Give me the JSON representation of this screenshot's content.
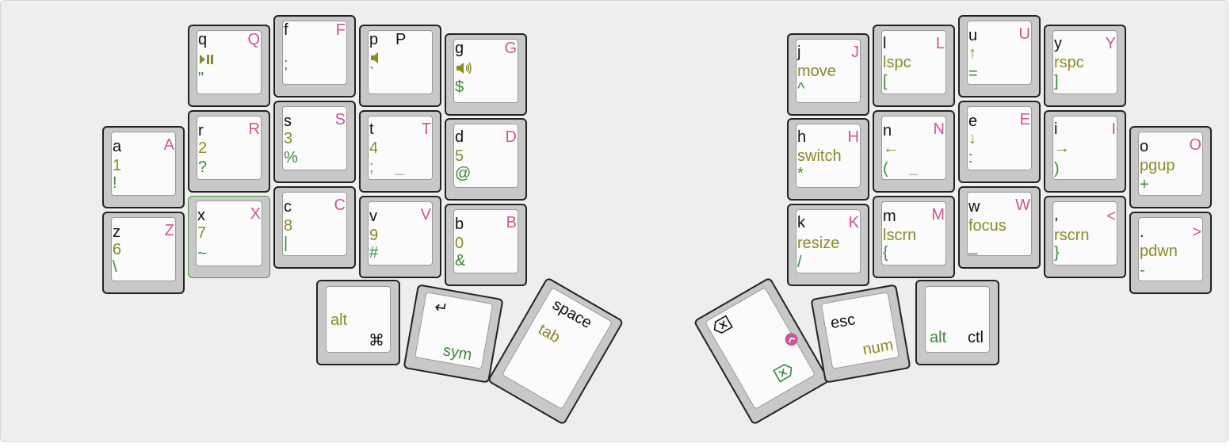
{
  "colors": {
    "base": "#111111",
    "shift": "#cc5599",
    "layer1": "#8a8a26",
    "layer2": "#3a8a3a",
    "dim": "#b0b0b0",
    "highlight": "#4a9a3a"
  },
  "left": {
    "q": {
      "base": "q",
      "shift": "Q",
      "l1": "⏯",
      "l2": "\""
    },
    "f": {
      "base": "f",
      "shift": "F",
      "l1": "",
      "l2": ";"
    },
    "p": {
      "base": "p",
      "shift": "P",
      "l1": "🔈",
      "l2": "`"
    },
    "g": {
      "base": "g",
      "shift": "G",
      "l1": "🔊",
      "l2": "$"
    },
    "a": {
      "base": "a",
      "shift": "A",
      "l1": "1",
      "l2": "!"
    },
    "r": {
      "base": "r",
      "shift": "R",
      "l1": "2",
      "l2": "?"
    },
    "s": {
      "base": "s",
      "shift": "S",
      "l1": "3",
      "l2": "%"
    },
    "t": {
      "base": "t",
      "shift": "T",
      "l1": "4",
      "l2": ";",
      "l2b": "_"
    },
    "d": {
      "base": "d",
      "shift": "D",
      "l1": "5",
      "l2": "@"
    },
    "z": {
      "base": "z",
      "shift": "Z",
      "l1": "6",
      "l2": "\\"
    },
    "x": {
      "base": "x",
      "shift": "X",
      "l1": "7",
      "l2": "~"
    },
    "c": {
      "base": "c",
      "shift": "C",
      "l1": "8",
      "l2": "|"
    },
    "v": {
      "base": "v",
      "shift": "V",
      "l1": "9",
      "l2": "#"
    },
    "b": {
      "base": "b",
      "shift": "B",
      "l1": "0",
      "l2": "&"
    }
  },
  "right": {
    "j": {
      "base": "j",
      "shift": "J",
      "l1": "move",
      "l2": "^"
    },
    "l": {
      "base": "l",
      "shift": "L",
      "l1": "lspc",
      "l2": "["
    },
    "u": {
      "base": "u",
      "shift": "U",
      "l1": "↑",
      "l2": "="
    },
    "y": {
      "base": "y",
      "shift": "Y",
      "l1": "rspc",
      "l2": "]"
    },
    "h": {
      "base": "h",
      "shift": "H",
      "l1": "switch",
      "l2": "*"
    },
    "n": {
      "base": "n",
      "shift": "N",
      "l1": "←",
      "l2": "(",
      "l2b": "_"
    },
    "e": {
      "base": "e",
      "shift": "E",
      "l1": "↓",
      "l2": ":"
    },
    "i": {
      "base": "i",
      "shift": "I",
      "l1": "→",
      "l2": ")"
    },
    "o": {
      "base": "o",
      "shift": "O",
      "l1": "pgup",
      "l2": "+"
    },
    "k": {
      "base": "k",
      "shift": "K",
      "l1": "resize",
      "l2": "/"
    },
    "m": {
      "base": "m",
      "shift": "M",
      "l1": "lscrn",
      "l2": "{"
    },
    "w": {
      "base": "w",
      "shift": "W",
      "l1": "focus",
      "l2": "_"
    },
    "comma": {
      "base": ",",
      "shift": "<",
      "l1": "rscrn",
      "l2": "}"
    },
    "period": {
      "base": ".",
      "shift": ">",
      "l1": "pdwn",
      "l2": "-"
    }
  },
  "thumbs": {
    "alt_cmd": {
      "hold": "alt",
      "tap": "⌘"
    },
    "enter_sym": {
      "tap": "↵",
      "hold": "sym"
    },
    "space_tab": {
      "tap": "space",
      "hold": "tab"
    },
    "backspace": {
      "tap_icon": "backspace-icon",
      "hold_icon": "delete-icon",
      "extra_icon": "emoji-icon"
    },
    "esc_num": {
      "tap": "esc",
      "hold": "num"
    },
    "alt_ctl": {
      "hold": "alt",
      "tap": "ctl"
    }
  }
}
